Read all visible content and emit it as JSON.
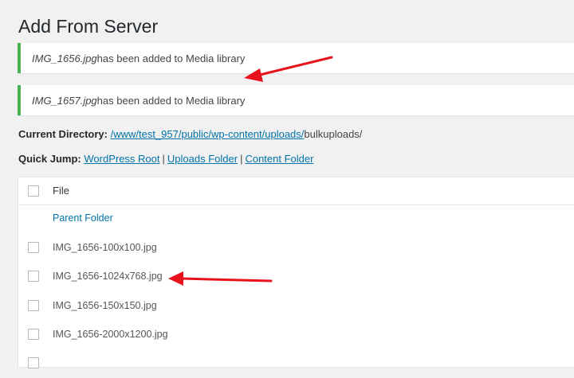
{
  "page": {
    "title": "Add From Server"
  },
  "notices": [
    {
      "filename": "IMG_1656.jpg",
      "message": " has been added to Media library"
    },
    {
      "filename": "IMG_1657.jpg",
      "message": " has been added to Media library"
    }
  ],
  "directory": {
    "label": "Current Directory:",
    "path_link": "/www/test_957/public/wp-content/uploads/",
    "path_rest": "bulkuploads/"
  },
  "quick_jump": {
    "label": "Quick Jump:",
    "links": [
      "WordPress Root",
      "Uploads Folder",
      "Content Folder"
    ],
    "separator": "|"
  },
  "file_table": {
    "header": "File",
    "parent_folder": "Parent Folder",
    "files": [
      "IMG_1656-100x100.jpg",
      "IMG_1656-1024x768.jpg",
      "IMG_1656-150x150.jpg",
      "IMG_1656-2000x1200.jpg"
    ]
  },
  "colors": {
    "success_border": "#46b450",
    "link": "#0073aa",
    "annotation_arrow": "#e8121c"
  }
}
